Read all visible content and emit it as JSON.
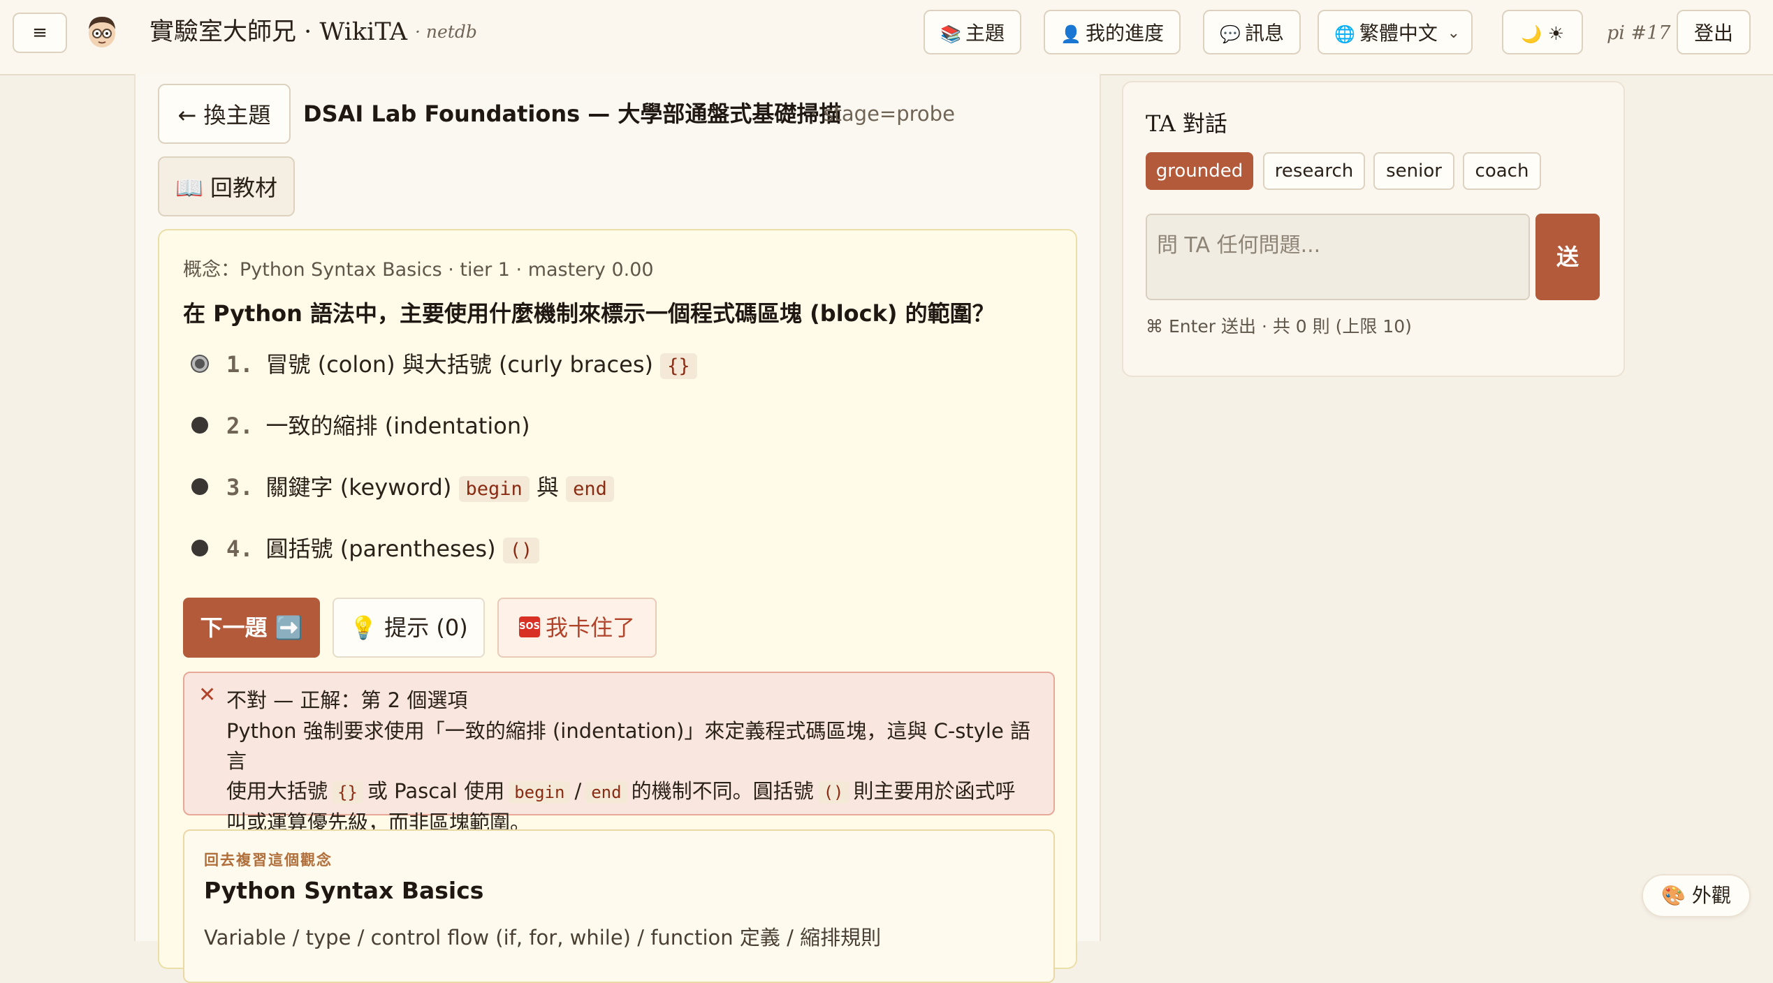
{
  "header": {
    "menu_icon": "hamburger-icon",
    "menu_label": "≡",
    "brand": "實驗室大師兄 · WikiTA",
    "brand_sub": "· netdb",
    "nav": {
      "topics": "主題",
      "progress": "我的進度",
      "messages": "訊息",
      "language": "繁體中文",
      "logout": "登出"
    },
    "icons": {
      "topics": "📚",
      "progress": "👤",
      "messages": "💬",
      "language": "🌐",
      "theme_moon": "🌙",
      "theme_sun": "☀"
    },
    "pi_tag": "pi #17"
  },
  "topic": {
    "back_label": "← 換主題",
    "title": "DSAI Lab Foundations — 大學部通盤式基礎掃描",
    "stage": "· stage=probe",
    "book_label": "📖 回教材"
  },
  "quiz": {
    "concept_meta": "概念：Python Syntax Basics · tier 1 · mastery 0.00",
    "question": "在 Python 語法中，主要使用什麼機制來標示一個程式碼區塊 (block) 的範圍？",
    "options": [
      {
        "num": "1.",
        "text": "冒號 (colon) 與大括號 (curly braces)",
        "code": "{}",
        "selected": true
      },
      {
        "num": "2.",
        "text": "一致的縮排 (indentation)",
        "selected": false
      },
      {
        "num": "3.",
        "text_a": "關鍵字 (keyword)",
        "code_a": "begin",
        "text_b": "與",
        "code_b": "end",
        "selected": false
      },
      {
        "num": "4.",
        "text": "圓括號 (parentheses)",
        "code": "()",
        "selected": false
      }
    ],
    "next_label": "下一題 ➡️",
    "hint_label": "💡 提示 (0)",
    "stuck_sos": "SOS",
    "stuck_label": "我卡住了"
  },
  "feedback": {
    "icon": "✕",
    "title": "不對 — 正解：第 2 個選項",
    "line1": "Python 強制要求使用「一致的縮排 (indentation)」來定義程式碼區塊，這與 C-style 語言",
    "line2_a": "使用大括號",
    "line2_code1": "{}",
    "line2_b": "或 Pascal 使用",
    "line2_code2": "begin",
    "line2_slash": "/",
    "line2_code3": "end",
    "line2_c": "的機制不同。圓括號",
    "line2_code4": "()",
    "line2_d": "則主要用於函式呼",
    "line3": "叫或運算優先級，而非區塊範圍。"
  },
  "review": {
    "kicker": "回去複習這個觀念",
    "title": "Python Syntax Basics",
    "desc": "Variable / type / control flow (if, for, while) / function 定義 / 縮排規則"
  },
  "ta": {
    "title": "TA 對話",
    "modes": [
      "grounded",
      "research",
      "senior",
      "coach"
    ],
    "active_mode": "grounded",
    "placeholder": "問 TA 任何問題...",
    "send_label": "送",
    "hint": "⌘ Enter 送出 · 共 0 則 (上限 10)"
  },
  "appearance": {
    "icon": "🎨",
    "label": "外觀"
  },
  "colors": {
    "accent": "#b35a3b",
    "background": "#f6f1e7",
    "card": "#fffbe8",
    "error_bg": "#f9e6df"
  }
}
